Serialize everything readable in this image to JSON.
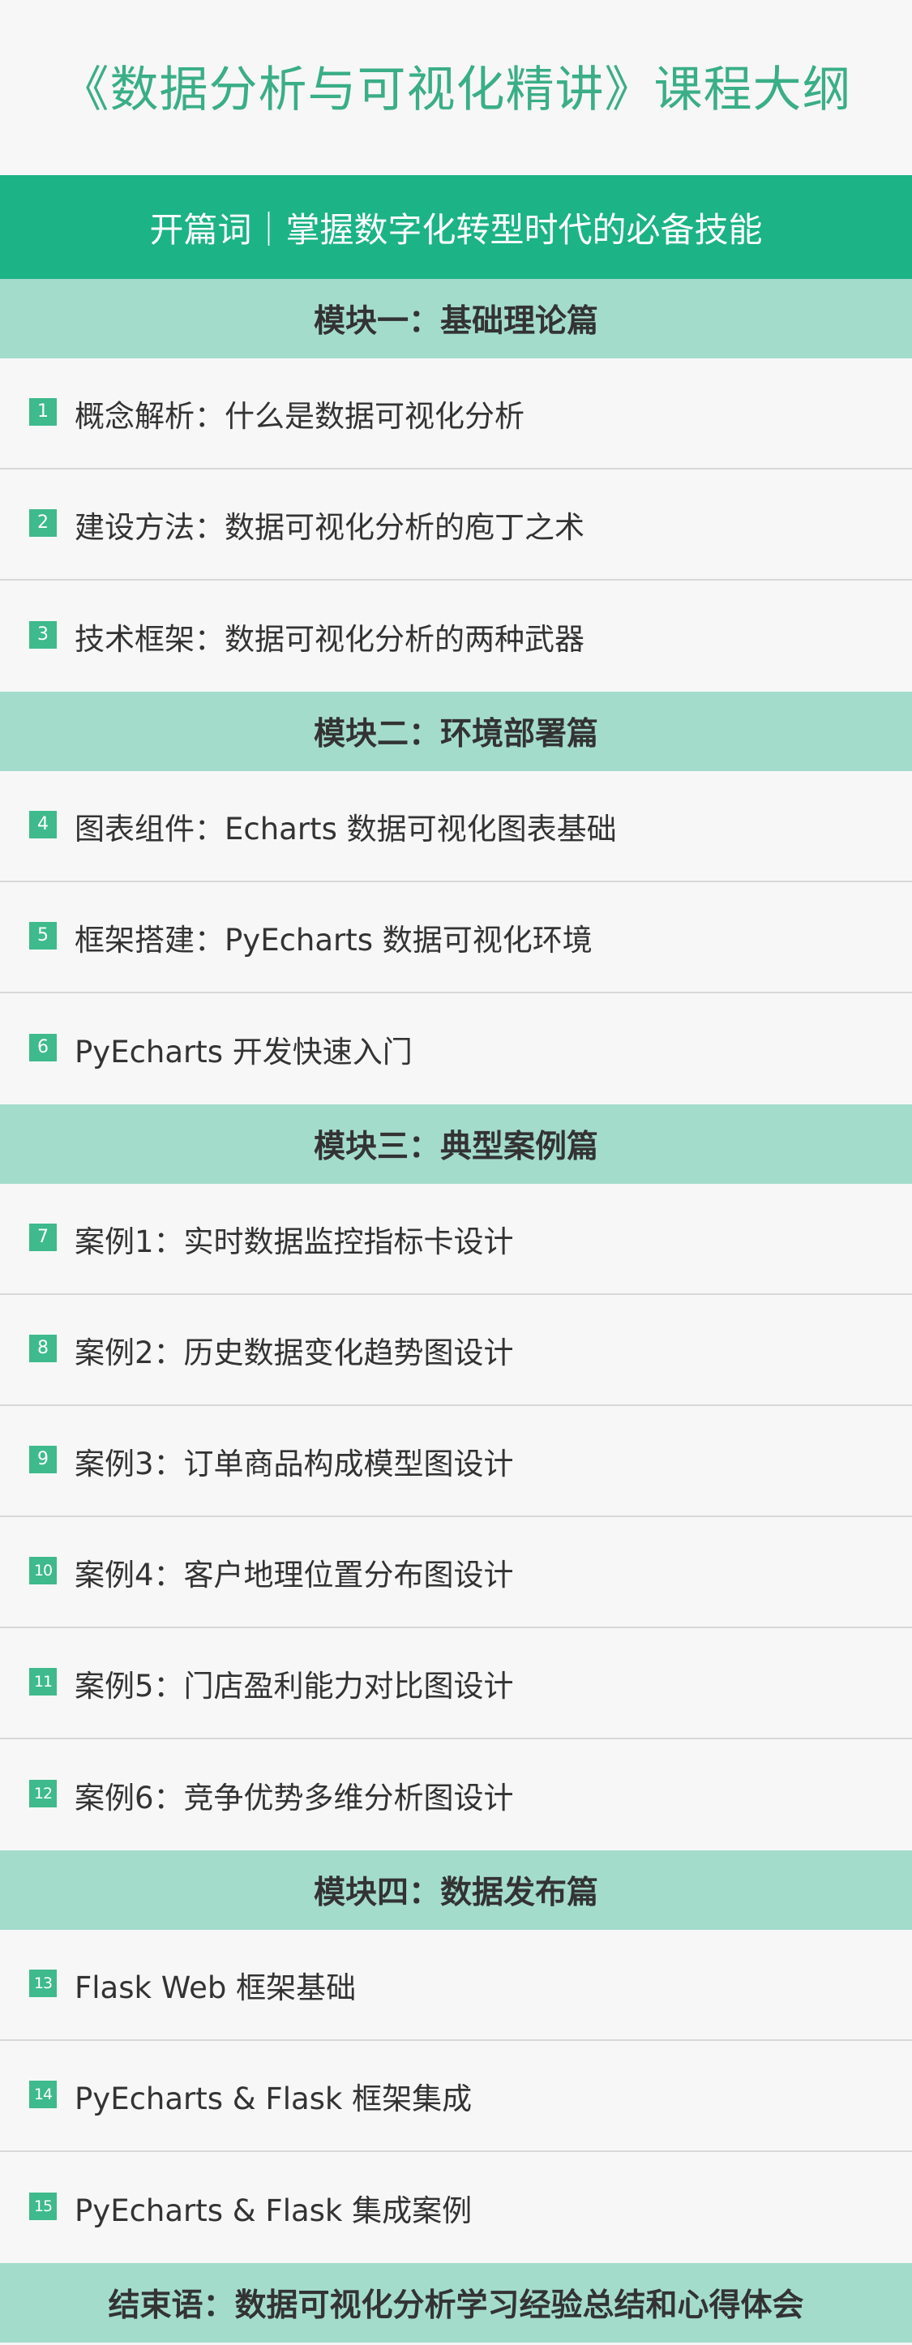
{
  "title": "《数据分析与可视化精讲》课程大纲",
  "intro": "开篇词｜掌握数字化转型时代的必备技能",
  "modules": [
    {
      "title": "模块一：基础理论篇",
      "items": [
        {
          "num": "1",
          "text": "概念解析：什么是数据可视化分析"
        },
        {
          "num": "2",
          "text": "建设方法：数据可视化分析的庖丁之术"
        },
        {
          "num": "3",
          "text": "技术框架：数据可视化分析的两种武器"
        }
      ]
    },
    {
      "title": "模块二：环境部署篇",
      "items": [
        {
          "num": "4",
          "text": "图表组件：Echarts 数据可视化图表基础"
        },
        {
          "num": "5",
          "text": "框架搭建：PyEcharts 数据可视化环境"
        },
        {
          "num": "6",
          "text": "PyEcharts 开发快速入门"
        }
      ]
    },
    {
      "title": "模块三：典型案例篇",
      "items": [
        {
          "num": "7",
          "text": "案例1：实时数据监控指标卡设计"
        },
        {
          "num": "8",
          "text": "案例2：历史数据变化趋势图设计"
        },
        {
          "num": "9",
          "text": "案例3：订单商品构成模型图设计"
        },
        {
          "num": "10",
          "text": "案例4：客户地理位置分布图设计"
        },
        {
          "num": "11",
          "text": "案例5：门店盈利能力对比图设计"
        },
        {
          "num": "12",
          "text": "案例6：竞争优势多维分析图设计"
        }
      ]
    },
    {
      "title": "模块四：数据发布篇",
      "items": [
        {
          "num": "13",
          "text": "Flask Web 框架基础"
        },
        {
          "num": "14",
          "text": "PyEcharts & Flask 框架集成"
        },
        {
          "num": "15",
          "text": "PyEcharts & Flask 集成案例"
        }
      ]
    }
  ],
  "ending": "结束语：数据可视化分析学习经验总结和心得体会",
  "colors": {
    "accent": "#1cb386",
    "title": "#3aae87",
    "module_bg": "#a4dccc",
    "badge": "#3eba8c",
    "page_bg": "#f7f7f7"
  }
}
